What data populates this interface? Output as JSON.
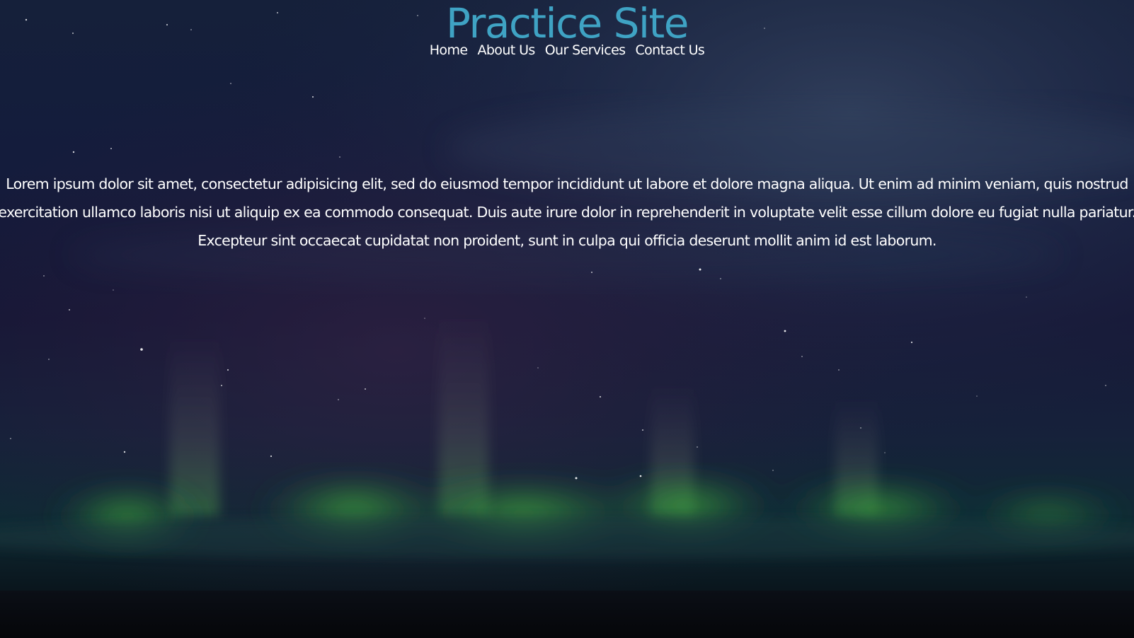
{
  "site": {
    "title": "Practice Site",
    "title_color": "#3fa3c4"
  },
  "nav": {
    "items": [
      {
        "label": "Home"
      },
      {
        "label": "About Us"
      },
      {
        "label": "Our Services"
      },
      {
        "label": "Contact Us"
      }
    ]
  },
  "main": {
    "paragraph": "Lorem ipsum dolor sit amet, consectetur adipisicing elit, sed do eiusmod tempor incididunt ut labore et dolore magna aliqua. Ut enim ad minim veniam, quis nostrud exercitation ullamco laboris nisi ut aliquip ex ea commodo consequat. Duis aute irure dolor in reprehenderit in voluptate velit esse cillum dolore eu fugiat nulla pariatur. Excepteur sint occaecat cupidatat non proident, sunt in culpa qui officia deserunt mollit anim id est laborum."
  },
  "background": {
    "description_icon": "aurora-night-sky-image",
    "sky_color": "#0d1633",
    "aurora_color": "#3fa844",
    "ground_color": "#05070c"
  }
}
